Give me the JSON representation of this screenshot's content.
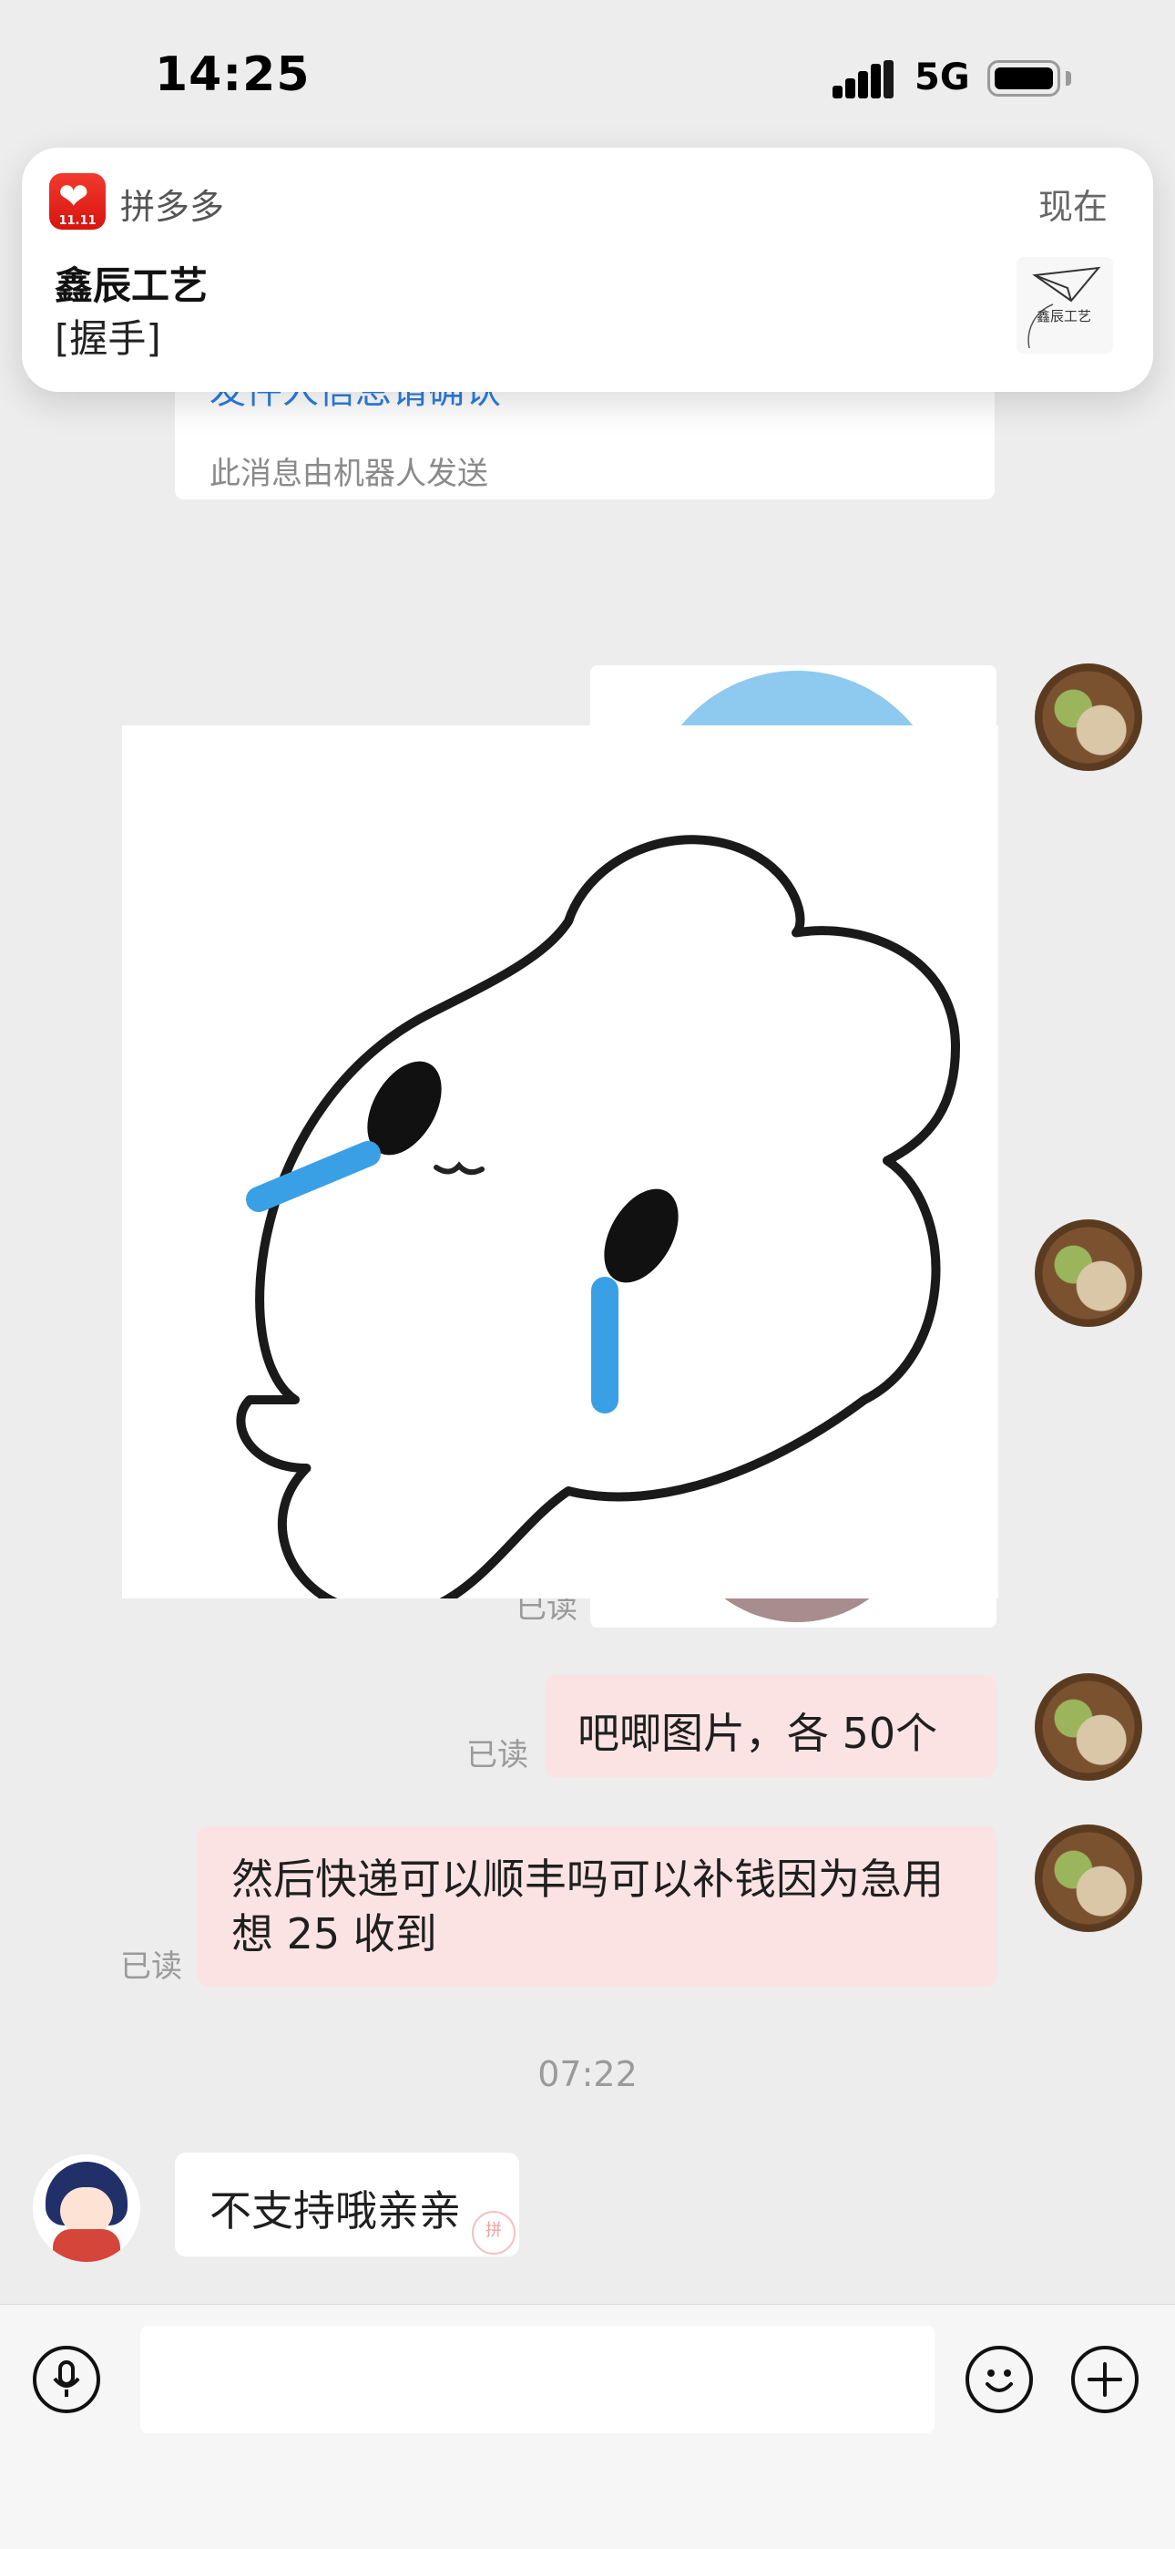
{
  "status_bar": {
    "time": "14:25",
    "network": "5G"
  },
  "notification": {
    "app_name": "拼多多",
    "app_icon_text": "11.11",
    "time": "现在",
    "title": "鑫辰工艺",
    "body": "[握手]",
    "thumbnail_text": "鑫辰工艺"
  },
  "chat": {
    "robot_card": {
      "link_text": "发件人信息请确认",
      "note": "此消息由机器人发送"
    },
    "read_label": "已读",
    "messages": [
      {
        "text": "吧唧图片，各 50个"
      },
      {
        "text": "然后快递可以顺丰吗可以补钱因为急用想 25 收到"
      }
    ],
    "timestamp": "07:22",
    "reply": {
      "text": "不支持哦亲亲",
      "stamp": "拼"
    }
  },
  "input_bar": {
    "placeholder": ""
  },
  "icons": {
    "voice": "microphone-icon",
    "emoji": "smiley-icon",
    "more": "plus-icon"
  },
  "colors": {
    "outgoing_bubble": "#fbe3e3",
    "link": "#2d7de0",
    "brand": "#e02e24"
  }
}
